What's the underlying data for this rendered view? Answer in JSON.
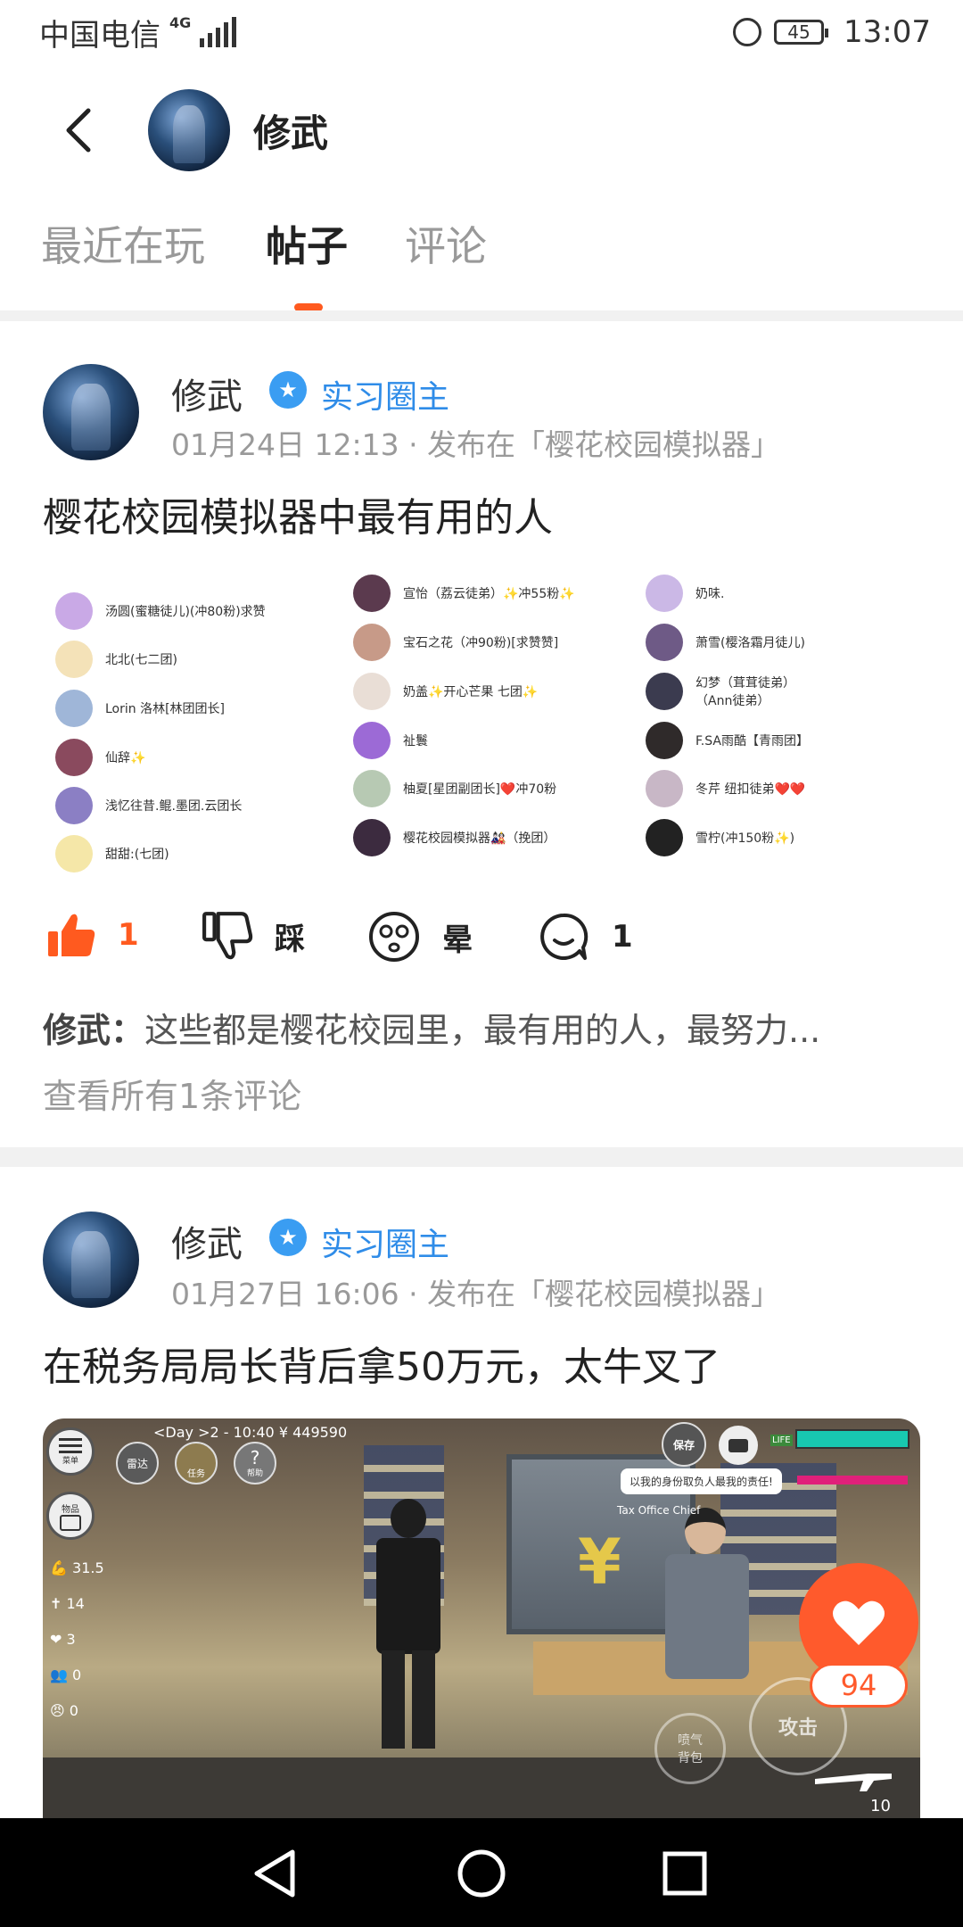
{
  "status_bar": {
    "carrier": "中国电信",
    "network": "4G",
    "battery": "45",
    "time": "13:07"
  },
  "header": {
    "name": "修武"
  },
  "tabs": [
    {
      "label": "最近在玩",
      "active": false
    },
    {
      "label": "帖子",
      "active": true
    },
    {
      "label": "评论",
      "active": false
    }
  ],
  "posts": [
    {
      "author": "修武",
      "badge": "实习圈主",
      "meta": "01月24日 12:13 · 发布在「樱花校园模拟器」",
      "title": "樱花校园模拟器中最有用的人",
      "collage": [
        [
          "汤圆(蜜糖徒儿)(冲80粉)求赞",
          "北北(七二团)",
          "Lorin 洛林[林团团长]",
          "仙辞✨",
          "浅忆往昔.鲲.墨团.云团长",
          "甜甜:(七团)"
        ],
        [
          "宣怡（荔云徒弟）✨冲55粉✨",
          "宝石之花（冲90粉)[求赞赞]",
          "奶盖✨开心芒果 七团✨",
          "祉鬟",
          "柚夏[星团副团长]❤️冲70粉",
          "樱花校园模拟器🎎（挽团）"
        ],
        [
          "奶味.",
          "萧雪(樱洛霜月徒儿)",
          "幻梦（茸茸徒弟）（Ann徒弟）",
          "F.SA雨酷【青雨团】",
          "冬芹    纽扣徒弟❤️❤️",
          "雪柠(冲150粉✨)"
        ]
      ],
      "actions": {
        "like_count": "1",
        "dislike_label": "踩",
        "dizzy_label": "晕",
        "comment_count": "1"
      },
      "comment_author": "修武：",
      "comment_text": "这些都是樱花校园里，最有用的人，最努力...",
      "view_all": "查看所有1条评论"
    },
    {
      "author": "修武",
      "badge": "实习圈主",
      "meta": "01月27日 16:06 · 发布在「樱花校园模拟器」",
      "title": "在税务局局长背后拿50万元，太牛叉了",
      "game_hud": {
        "day": "<Day >2 - 10:40  ¥ 449590",
        "save": "保存",
        "speech": "以我的身份取负人最我的责任!",
        "npc_name": "Tax Office Chief",
        "menu": "菜单",
        "radar": "雷达",
        "task": "任务",
        "help": "帮助",
        "items": "物品",
        "stats": [
          "31.5",
          "14",
          "3",
          "0",
          "0"
        ],
        "attack": "攻击",
        "bag": "喷气背包",
        "ammo": "10",
        "life": "LIFE"
      }
    }
  ],
  "like_fab": {
    "count": "94"
  },
  "colors": {
    "accent": "#ff5a1f",
    "badge_blue": "#3a9df2",
    "badge_text": "#2f8ce8"
  }
}
